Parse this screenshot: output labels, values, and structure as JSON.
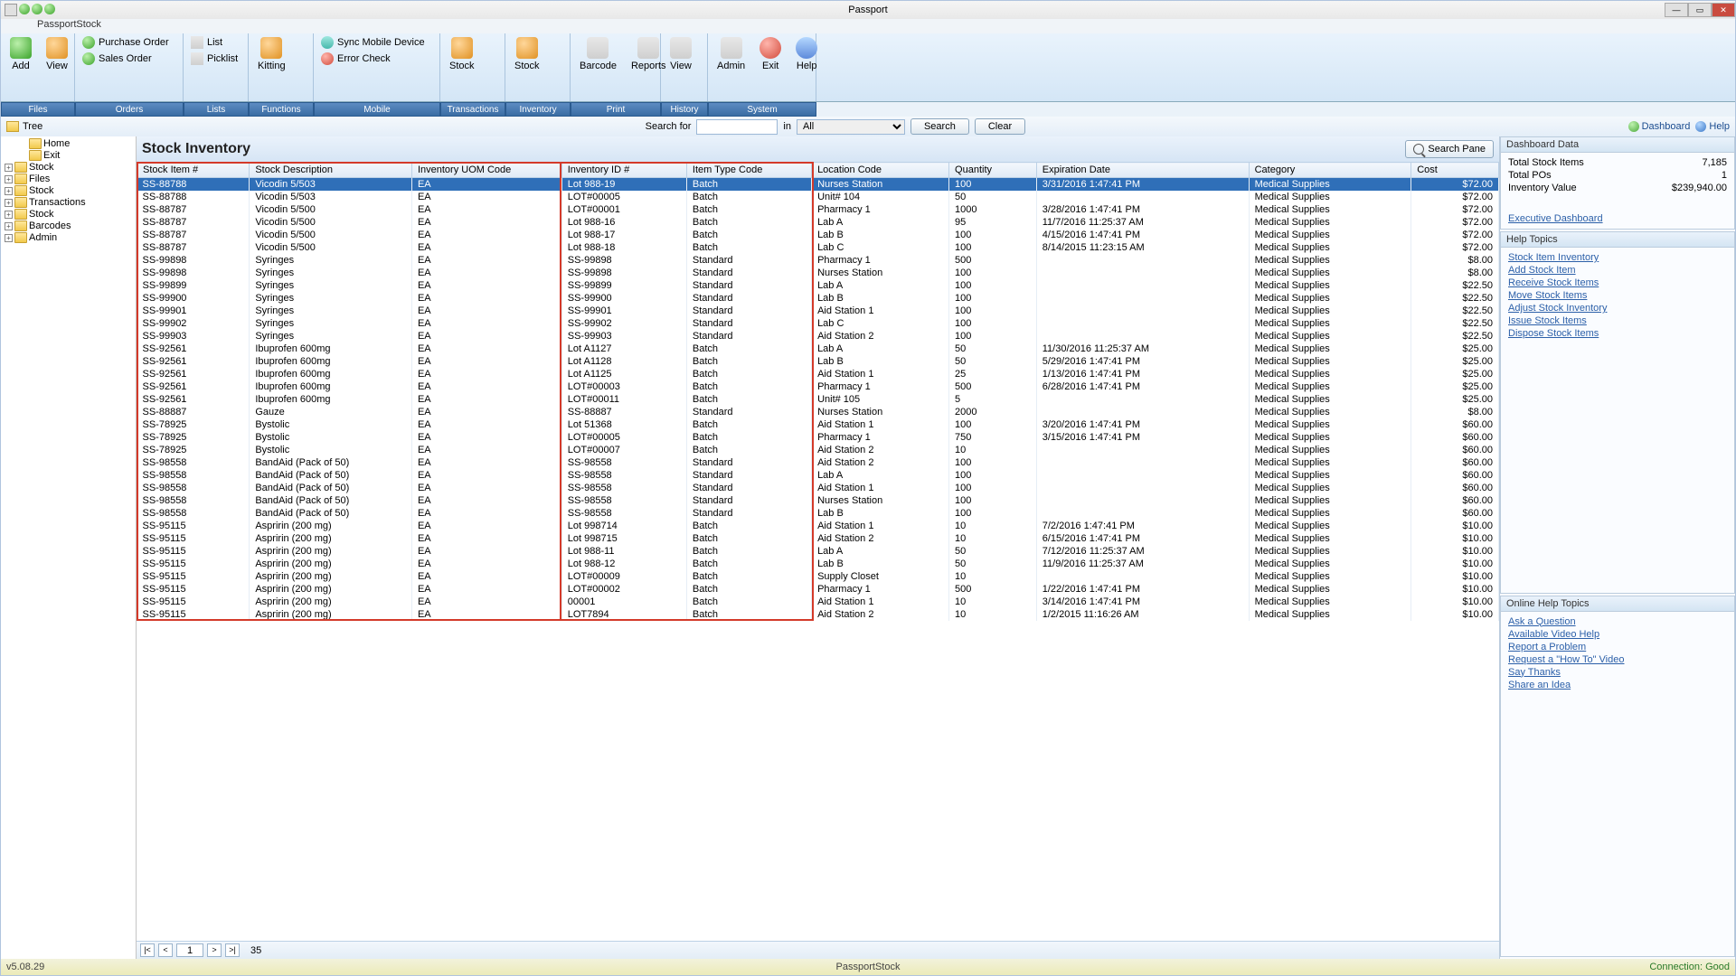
{
  "window": {
    "title": "Passport",
    "subtitle": "PassportStock"
  },
  "ribbon": {
    "files": {
      "tab": "Files",
      "add": "Add",
      "view": "View"
    },
    "orders": {
      "tab": "Orders",
      "po": "Purchase Order",
      "so": "Sales Order"
    },
    "lists": {
      "tab": "Lists",
      "list": "List",
      "picklist": "Picklist"
    },
    "functions": {
      "tab": "Functions",
      "kitting": "Kitting"
    },
    "mobile": {
      "tab": "Mobile",
      "sync": "Sync Mobile Device",
      "error": "Error Check"
    },
    "transactions": {
      "tab": "Transactions",
      "stock": "Stock"
    },
    "inventory": {
      "tab": "Inventory",
      "stock": "Stock"
    },
    "print": {
      "tab": "Print",
      "barcode": "Barcode",
      "reports": "Reports"
    },
    "history": {
      "tab": "History",
      "view": "View"
    },
    "system": {
      "tab": "System",
      "admin": "Admin",
      "exit": "Exit",
      "help": "Help"
    }
  },
  "searchbar": {
    "tree_label": "Tree",
    "search_for": "Search for",
    "in": "in",
    "all_option": "All",
    "search": "Search",
    "clear": "Clear",
    "dashboard": "Dashboard",
    "help": "Help"
  },
  "tree": {
    "items": [
      {
        "label": "Home",
        "exp": ""
      },
      {
        "label": "Exit",
        "exp": ""
      },
      {
        "label": "Stock",
        "exp": "+"
      },
      {
        "label": "Files",
        "exp": "+"
      },
      {
        "label": "Stock",
        "exp": "+"
      },
      {
        "label": "Transactions",
        "exp": "+"
      },
      {
        "label": "Stock",
        "exp": "+"
      },
      {
        "label": "Barcodes",
        "exp": "+"
      },
      {
        "label": "Admin",
        "exp": "+"
      }
    ]
  },
  "main": {
    "title": "Stock Inventory",
    "search_pane": "Search Pane",
    "columns": [
      "Stock Item #",
      "Stock Description",
      "Inventory UOM Code",
      "Inventory ID #",
      "Item Type Code",
      "Location Code",
      "Quantity",
      "Expiration Date",
      "Category",
      "Cost"
    ],
    "rows": [
      [
        "SS-88788",
        "Vicodin 5/503",
        "EA",
        "Lot 988-19",
        "Batch",
        "Nurses Station",
        "100",
        "3/31/2016 1:47:41 PM",
        "Medical Supplies",
        "$72.00"
      ],
      [
        "SS-88788",
        "Vicodin 5/503",
        "EA",
        "LOT#00005",
        "Batch",
        "Unit# 104",
        "50",
        "",
        "Medical Supplies",
        "$72.00"
      ],
      [
        "SS-88787",
        "Vicodin 5/500",
        "EA",
        "LOT#00001",
        "Batch",
        "Pharmacy 1",
        "1000",
        "3/28/2016 1:47:41 PM",
        "Medical Supplies",
        "$72.00"
      ],
      [
        "SS-88787",
        "Vicodin 5/500",
        "EA",
        "Lot 988-16",
        "Batch",
        "Lab A",
        "95",
        "11/7/2016 11:25:37 AM",
        "Medical Supplies",
        "$72.00"
      ],
      [
        "SS-88787",
        "Vicodin 5/500",
        "EA",
        "Lot 988-17",
        "Batch",
        "Lab B",
        "100",
        "4/15/2016 1:47:41 PM",
        "Medical Supplies",
        "$72.00"
      ],
      [
        "SS-88787",
        "Vicodin 5/500",
        "EA",
        "Lot 988-18",
        "Batch",
        "Lab C",
        "100",
        "8/14/2015 11:23:15 AM",
        "Medical Supplies",
        "$72.00"
      ],
      [
        "SS-99898",
        "Syringes",
        "EA",
        "SS-99898",
        "Standard",
        "Pharmacy 1",
        "500",
        "",
        "Medical Supplies",
        "$8.00"
      ],
      [
        "SS-99898",
        "Syringes",
        "EA",
        "SS-99898",
        "Standard",
        "Nurses Station",
        "100",
        "",
        "Medical Supplies",
        "$8.00"
      ],
      [
        "SS-99899",
        "Syringes",
        "EA",
        "SS-99899",
        "Standard",
        "Lab A",
        "100",
        "",
        "Medical Supplies",
        "$22.50"
      ],
      [
        "SS-99900",
        "Syringes",
        "EA",
        "SS-99900",
        "Standard",
        "Lab B",
        "100",
        "",
        "Medical Supplies",
        "$22.50"
      ],
      [
        "SS-99901",
        "Syringes",
        "EA",
        "SS-99901",
        "Standard",
        "Aid Station 1",
        "100",
        "",
        "Medical Supplies",
        "$22.50"
      ],
      [
        "SS-99902",
        "Syringes",
        "EA",
        "SS-99902",
        "Standard",
        "Lab C",
        "100",
        "",
        "Medical Supplies",
        "$22.50"
      ],
      [
        "SS-99903",
        "Syringes",
        "EA",
        "SS-99903",
        "Standard",
        "Aid Station 2",
        "100",
        "",
        "Medical Supplies",
        "$22.50"
      ],
      [
        "SS-92561",
        "Ibuprofen 600mg",
        "EA",
        "Lot A1127",
        "Batch",
        "Lab A",
        "50",
        "11/30/2016 11:25:37 AM",
        "Medical Supplies",
        "$25.00"
      ],
      [
        "SS-92561",
        "Ibuprofen 600mg",
        "EA",
        "Lot A1128",
        "Batch",
        "Lab B",
        "50",
        "5/29/2016 1:47:41 PM",
        "Medical Supplies",
        "$25.00"
      ],
      [
        "SS-92561",
        "Ibuprofen 600mg",
        "EA",
        "Lot A1125",
        "Batch",
        "Aid Station 1",
        "25",
        "1/13/2016 1:47:41 PM",
        "Medical Supplies",
        "$25.00"
      ],
      [
        "SS-92561",
        "Ibuprofen 600mg",
        "EA",
        "LOT#00003",
        "Batch",
        "Pharmacy 1",
        "500",
        "6/28/2016 1:47:41 PM",
        "Medical Supplies",
        "$25.00"
      ],
      [
        "SS-92561",
        "Ibuprofen 600mg",
        "EA",
        "LOT#00011",
        "Batch",
        "Unit# 105",
        "5",
        "",
        "Medical Supplies",
        "$25.00"
      ],
      [
        "SS-88887",
        "Gauze",
        "EA",
        "SS-88887",
        "Standard",
        "Nurses Station",
        "2000",
        "",
        "Medical Supplies",
        "$8.00"
      ],
      [
        "SS-78925",
        "Bystolic",
        "EA",
        "Lot 51368",
        "Batch",
        "Aid Station 1",
        "100",
        "3/20/2016 1:47:41 PM",
        "Medical Supplies",
        "$60.00"
      ],
      [
        "SS-78925",
        "Bystolic",
        "EA",
        "LOT#00005",
        "Batch",
        "Pharmacy 1",
        "750",
        "3/15/2016 1:47:41 PM",
        "Medical Supplies",
        "$60.00"
      ],
      [
        "SS-78925",
        "Bystolic",
        "EA",
        "LOT#00007",
        "Batch",
        "Aid Station 2",
        "10",
        "",
        "Medical Supplies",
        "$60.00"
      ],
      [
        "SS-98558",
        "BandAid (Pack of 50)",
        "EA",
        "SS-98558",
        "Standard",
        "Aid Station 2",
        "100",
        "",
        "Medical Supplies",
        "$60.00"
      ],
      [
        "SS-98558",
        "BandAid (Pack of 50)",
        "EA",
        "SS-98558",
        "Standard",
        "Lab A",
        "100",
        "",
        "Medical Supplies",
        "$60.00"
      ],
      [
        "SS-98558",
        "BandAid (Pack of 50)",
        "EA",
        "SS-98558",
        "Standard",
        "Aid Station 1",
        "100",
        "",
        "Medical Supplies",
        "$60.00"
      ],
      [
        "SS-98558",
        "BandAid (Pack of 50)",
        "EA",
        "SS-98558",
        "Standard",
        "Nurses Station",
        "100",
        "",
        "Medical Supplies",
        "$60.00"
      ],
      [
        "SS-98558",
        "BandAid (Pack of 50)",
        "EA",
        "SS-98558",
        "Standard",
        "Lab B",
        "100",
        "",
        "Medical Supplies",
        "$60.00"
      ],
      [
        "SS-95115",
        "Aspririn (200 mg)",
        "EA",
        "Lot 998714",
        "Batch",
        "Aid Station 1",
        "10",
        "7/2/2016 1:47:41 PM",
        "Medical Supplies",
        "$10.00"
      ],
      [
        "SS-95115",
        "Aspririn (200 mg)",
        "EA",
        "Lot 998715",
        "Batch",
        "Aid Station 2",
        "10",
        "6/15/2016 1:47:41 PM",
        "Medical Supplies",
        "$10.00"
      ],
      [
        "SS-95115",
        "Aspririn (200 mg)",
        "EA",
        "Lot 988-11",
        "Batch",
        "Lab A",
        "50",
        "7/12/2016 11:25:37 AM",
        "Medical Supplies",
        "$10.00"
      ],
      [
        "SS-95115",
        "Aspririn (200 mg)",
        "EA",
        "Lot 988-12",
        "Batch",
        "Lab B",
        "50",
        "11/9/2016 11:25:37 AM",
        "Medical Supplies",
        "$10.00"
      ],
      [
        "SS-95115",
        "Aspririn (200 mg)",
        "EA",
        "LOT#00009",
        "Batch",
        "Supply Closet",
        "10",
        "",
        "Medical Supplies",
        "$10.00"
      ],
      [
        "SS-95115",
        "Aspririn (200 mg)",
        "EA",
        "LOT#00002",
        "Batch",
        "Pharmacy 1",
        "500",
        "1/22/2016 1:47:41 PM",
        "Medical Supplies",
        "$10.00"
      ],
      [
        "SS-95115",
        "Aspririn (200 mg)",
        "EA",
        "00001",
        "Batch",
        "Aid Station 1",
        "10",
        "3/14/2016 1:47:41 PM",
        "Medical Supplies",
        "$10.00"
      ],
      [
        "SS-95115",
        "Aspririn (200 mg)",
        "EA",
        "LOT7894",
        "Batch",
        "Aid Station 2",
        "10",
        "1/2/2015 11:16:26 AM",
        "Medical Supplies",
        "$10.00"
      ]
    ],
    "pager": {
      "page": "1",
      "total": "35"
    }
  },
  "dashboard": {
    "title": "Dashboard Data",
    "rows": [
      {
        "k": "Total Stock Items",
        "v": "7,185"
      },
      {
        "k": "Total POs",
        "v": "1"
      },
      {
        "k": "Inventory Value",
        "v": "$239,940.00"
      }
    ],
    "exec_link": "Executive Dashboard"
  },
  "help_topics": {
    "title": "Help Topics",
    "links": [
      "Stock Item Inventory",
      "Add Stock Item",
      "Receive Stock Items",
      "Move Stock Items",
      "Adjust Stock Inventory",
      "Issue Stock Items",
      "Dispose Stock Items"
    ]
  },
  "online_help": {
    "title": "Online Help Topics",
    "links": [
      "Ask a Question",
      "Available Video Help",
      "Report a Problem",
      "Request a \"How To\" Video",
      "Say Thanks",
      "Share an Idea"
    ]
  },
  "status": {
    "left": "v5.08.29",
    "mid": "PassportStock",
    "right": "Connection: Good"
  }
}
